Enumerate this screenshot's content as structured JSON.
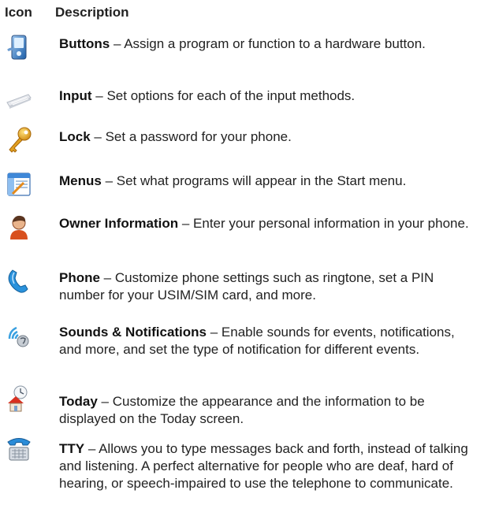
{
  "header": {
    "icon_col": "Icon",
    "desc_col": "Description"
  },
  "rows": [
    {
      "title": "Buttons",
      "sep": " – ",
      "desc": "Assign a program or function to a hardware button.",
      "icon": "handset-button-icon"
    },
    {
      "title": "Input",
      "sep": " – ",
      "desc": "Set options for each of the input methods.",
      "icon": "keyboard-icon"
    },
    {
      "title": "Lock",
      "sep": " – ",
      "desc": "Set a password for your phone.",
      "icon": "key-icon"
    },
    {
      "title": "Menus",
      "sep": " – ",
      "desc": "Set what programs will appear in the Start menu.",
      "icon": "menu-window-icon"
    },
    {
      "title": "Owner Information",
      "sep": " – ",
      "desc": "Enter your personal information in your phone.",
      "icon": "person-icon"
    },
    {
      "title": "Phone",
      "sep": " – ",
      "desc": "Customize phone settings such as ringtone, set a PIN number for your USIM/SIM card, and more.",
      "icon": "phone-receiver-icon"
    },
    {
      "title": "Sounds & Notifications",
      "sep": " – ",
      "desc": "Enable sounds for events, notifications, and more, and set the type of notification for different events.",
      "icon": "sound-waves-icon"
    },
    {
      "title": "Today",
      "sep": " – ",
      "desc": "Customize the appearance and the information to be displayed on the Today screen.",
      "icon": "today-home-icon"
    },
    {
      "title": "TTY",
      "sep": " – ",
      "desc": "Allows you to type messages back and forth, instead of talking and listening. A perfect alternative for people who are deaf, hard of hearing, or speech-impaired to use the telephone to communicate.",
      "icon": "tty-phone-icon"
    }
  ]
}
